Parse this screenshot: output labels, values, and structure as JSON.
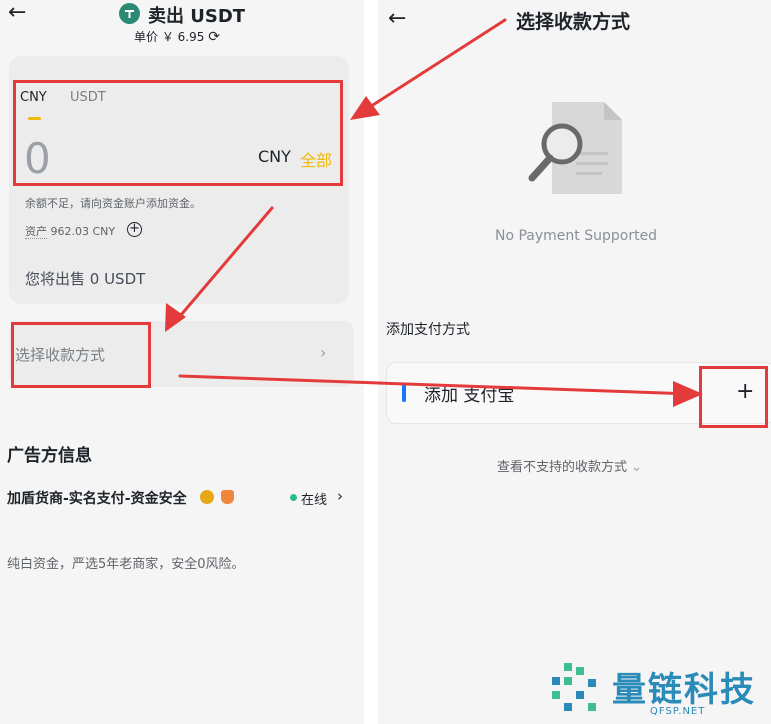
{
  "left": {
    "title": "卖出 USDT",
    "unit_price_label": "单价 ￥ 6.95",
    "tabs": [
      {
        "label": "CNY",
        "active": true
      },
      {
        "label": "USDT",
        "active": false
      }
    ],
    "amount_value": "0",
    "amount_currency": "CNY",
    "all_label": "全部",
    "insufficient_hint": "余额不足，请向资金账户添加资金。",
    "asset_label": "资产",
    "asset_value": "962.03 CNY",
    "sell_summary": "您将出售 0 USDT",
    "select_payment_label": "选择收款方式",
    "advertiser_section": "广告方信息",
    "merchant_name": "加盾货商-实名支付-资金安全",
    "online_label": "在线",
    "merchant_desc": "纯白资金，严选5年老商家，安全0风险。"
  },
  "right": {
    "title": "选择收款方式",
    "empty_text": "No Payment Supported",
    "add_section": "添加支付方式",
    "alipay_label": "添加 支付宝",
    "unsupported_link": "查看不支持的收款方式"
  },
  "watermark": {
    "text": "量链科技",
    "sub": "QFSP.NET"
  },
  "colors": {
    "accent": "#f0b90b",
    "annotation": "#e33b3b",
    "online": "#2ebd85",
    "alipay": "#1677ff"
  }
}
